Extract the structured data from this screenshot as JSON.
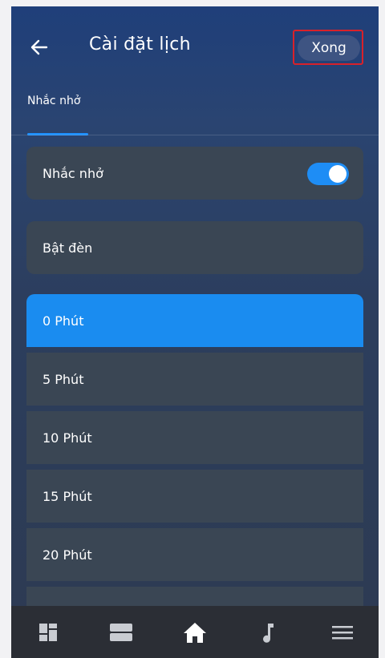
{
  "header": {
    "title": "Cài đặt lịch",
    "done_label": "Xong"
  },
  "tabs": [
    {
      "label": "Nhắc nhở",
      "active": true
    }
  ],
  "reminder": {
    "label": "Nhắc nhở",
    "enabled": true
  },
  "light": {
    "label": "Bật đèn"
  },
  "options": [
    {
      "label": "0 Phút",
      "selected": true
    },
    {
      "label": "5 Phút",
      "selected": false
    },
    {
      "label": "10 Phút",
      "selected": false
    },
    {
      "label": "15 Phút",
      "selected": false
    },
    {
      "label": "20 Phút",
      "selected": false
    }
  ],
  "bottom_nav": [
    {
      "icon": "dashboard-icon"
    },
    {
      "icon": "devices-icon"
    },
    {
      "icon": "home-icon",
      "active": true
    },
    {
      "icon": "music-icon"
    },
    {
      "icon": "menu-icon"
    }
  ],
  "colors": {
    "accent": "#1a8cf0",
    "highlight_frame": "#d9212a",
    "card": "#3a4654",
    "nav_bg": "#2b2e35"
  }
}
